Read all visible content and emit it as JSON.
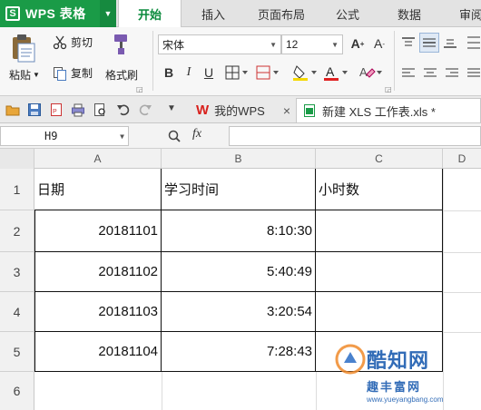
{
  "app": {
    "name": "WPS 表格",
    "logo_letter": "S"
  },
  "tabs": [
    "开始",
    "插入",
    "页面布局",
    "公式",
    "数据",
    "审阅"
  ],
  "active_tab": "开始",
  "ribbon": {
    "paste": "粘贴",
    "cut": "剪切",
    "copy": "复制",
    "format_painter": "格式刷",
    "font_name": "宋体",
    "font_size": "12",
    "bold": "B",
    "italic": "I",
    "underline": "U"
  },
  "doc_tabs": [
    {
      "label": "我的WPS",
      "close": "×"
    },
    {
      "label": "新建 XLS 工作表.xls *"
    }
  ],
  "formula_bar": {
    "name_box": "H9",
    "fx": "fx",
    "value": ""
  },
  "columns": [
    "A",
    "B",
    "C",
    "D"
  ],
  "rows": [
    "1",
    "2",
    "3",
    "4",
    "5",
    "6"
  ],
  "table": {
    "headers": [
      "日期",
      "学习时间",
      "小时数"
    ],
    "data": [
      [
        "20181101",
        "8:10:30",
        ""
      ],
      [
        "20181102",
        "5:40:49",
        ""
      ],
      [
        "20181103",
        "3:20:54",
        ""
      ],
      [
        "20181104",
        "7:28:43",
        ""
      ]
    ]
  },
  "watermark": {
    "main": "酷知网",
    "sub": "趣丰富网",
    "url": "www.yueyangbang.com"
  },
  "colors": {
    "brand": "#1a9b47",
    "active_tab_text": "#0a8a3c",
    "grid_border": "#111111"
  }
}
